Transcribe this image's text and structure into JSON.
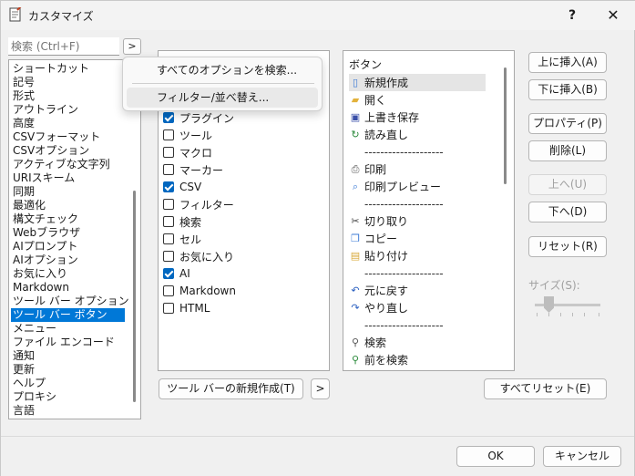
{
  "window": {
    "title": "カスタマイズ",
    "help": "?",
    "close": "✕"
  },
  "search": {
    "placeholder": "検索 (Ctrl+F)",
    "arrow": ">"
  },
  "categories": [
    {
      "label": "ショートカット"
    },
    {
      "label": "記号"
    },
    {
      "label": "形式"
    },
    {
      "label": "アウトライン"
    },
    {
      "label": "高度"
    },
    {
      "label": "CSVフォーマット"
    },
    {
      "label": "CSVオプション"
    },
    {
      "label": "アクティブな文字列"
    },
    {
      "label": "URIスキーム"
    },
    {
      "label": "同期"
    },
    {
      "label": "最適化"
    },
    {
      "label": "構文チェック"
    },
    {
      "label": "Webブラウザ"
    },
    {
      "label": "AIプロンプト"
    },
    {
      "label": "AIオプション"
    },
    {
      "label": "お気に入り"
    },
    {
      "label": "Markdown"
    },
    {
      "label": "ツール バー オプション"
    },
    {
      "label": "ツール バー ボタン",
      "selected": true
    },
    {
      "label": "メニュー"
    },
    {
      "label": "ファイル エンコード"
    },
    {
      "label": "通知"
    },
    {
      "label": "更新"
    },
    {
      "label": "ヘルプ"
    },
    {
      "label": "プロキシ"
    },
    {
      "label": "言語"
    }
  ],
  "popup": {
    "items": [
      {
        "label": "すべてのオプションを検索..."
      },
      {
        "label": "フィルター/並べ替え..."
      }
    ]
  },
  "toolbars": [
    {
      "label": "プラグイン",
      "checked": true
    },
    {
      "label": "ツール",
      "checked": false
    },
    {
      "label": "マクロ",
      "checked": false
    },
    {
      "label": "マーカー",
      "checked": false
    },
    {
      "label": "CSV",
      "checked": true
    },
    {
      "label": "フィルター",
      "checked": false
    },
    {
      "label": "検索",
      "checked": false
    },
    {
      "label": "セル",
      "checked": false
    },
    {
      "label": "お気に入り",
      "checked": false
    },
    {
      "label": "AI",
      "checked": true
    },
    {
      "label": "Markdown",
      "checked": false
    },
    {
      "label": "HTML",
      "checked": false
    }
  ],
  "buttons_list": {
    "header": "ボタン",
    "items": [
      {
        "label": "新規作成",
        "icon": "new-file-icon",
        "selected": true
      },
      {
        "label": "開く",
        "icon": "open-folder-icon"
      },
      {
        "label": "上書き保存",
        "icon": "save-icon"
      },
      {
        "label": "読み直し",
        "icon": "reload-icon"
      },
      {
        "label": "--------------------",
        "separator": true
      },
      {
        "label": "印刷",
        "icon": "print-icon"
      },
      {
        "label": "印刷プレビュー",
        "icon": "print-preview-icon"
      },
      {
        "label": "--------------------",
        "separator": true
      },
      {
        "label": "切り取り",
        "icon": "cut-icon"
      },
      {
        "label": "コピー",
        "icon": "copy-icon"
      },
      {
        "label": "貼り付け",
        "icon": "paste-icon"
      },
      {
        "label": "--------------------",
        "separator": true
      },
      {
        "label": "元に戻す",
        "icon": "undo-icon"
      },
      {
        "label": "やり直し",
        "icon": "redo-icon"
      },
      {
        "label": "--------------------",
        "separator": true
      },
      {
        "label": "検索",
        "icon": "find-icon"
      },
      {
        "label": "前を検索",
        "icon": "find-prev-icon"
      }
    ]
  },
  "actions": {
    "insert_above": "上に挿入(A)",
    "insert_below": "下に挿入(B)",
    "properties": "プロパティ(P)",
    "delete": "削除(L)",
    "move_up": "上へ(U)",
    "move_down": "下へ(D)",
    "reset": "リセット(R)",
    "size_label": "サイズ(S):",
    "new_toolbar": "ツール バーの新規作成(T)",
    "more": ">",
    "reset_all": "すべてリセット(E)"
  },
  "footer": {
    "ok": "OK",
    "cancel": "キャンセル"
  },
  "colors": {
    "accent": "#0078d7",
    "check": "#0067c0"
  }
}
